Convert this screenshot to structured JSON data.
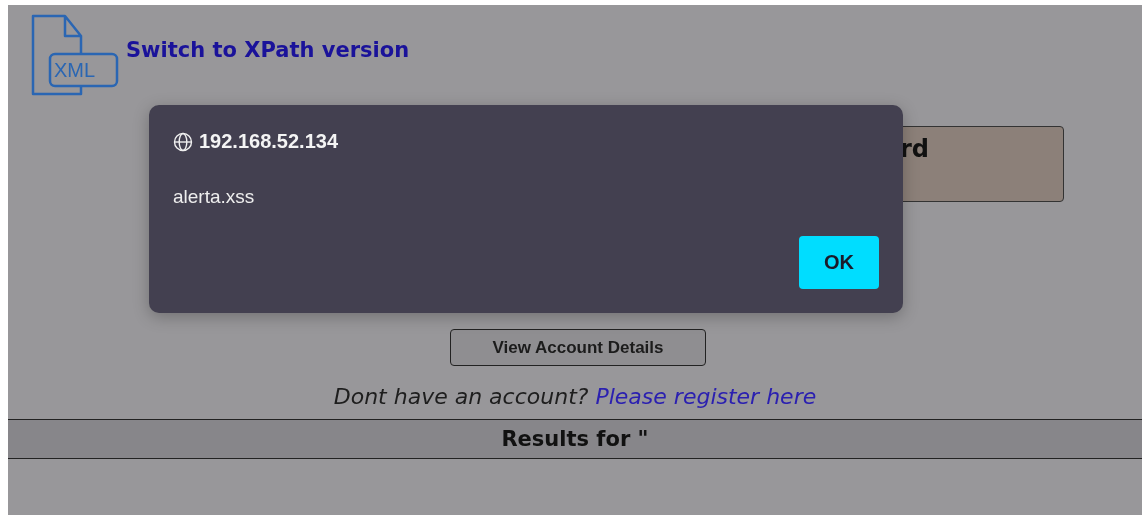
{
  "header": {
    "icon_label": "XML",
    "link": "Switch to XPath version"
  },
  "card": {
    "heading": "rd"
  },
  "dialog": {
    "origin": "192.168.52.134",
    "message": "alerta.xss",
    "button": "OK"
  },
  "form": {
    "button": "View Account Details",
    "prompt": "Dont have an account?",
    "register_link": "Please register here"
  },
  "results": {
    "title": "Results for \""
  }
}
